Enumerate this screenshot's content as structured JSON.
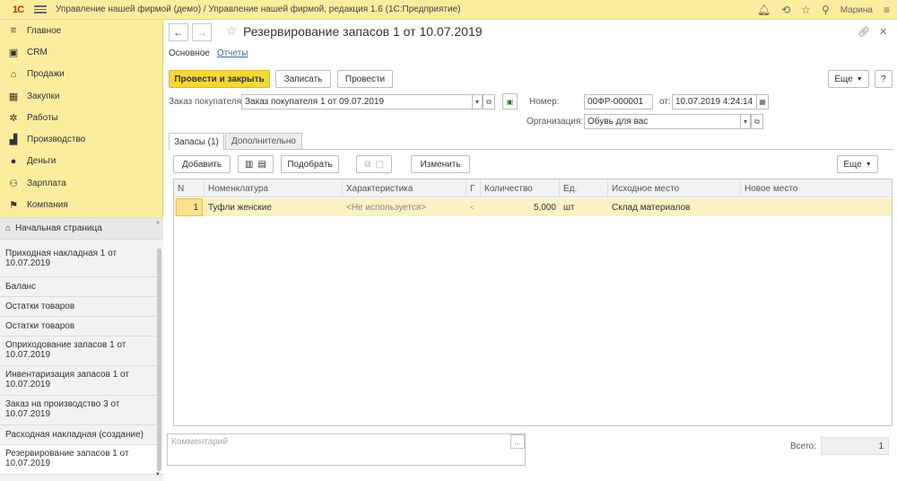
{
  "topbar": {
    "logo": "1C",
    "title": "Управление нашей фирмой (демо) / Управление нашей фирмой, редакция 1.6  (1С:Предприятие)",
    "user": "Марина"
  },
  "sidebar": {
    "items": [
      {
        "label": "Главное",
        "icon": "menu-lines-icon"
      },
      {
        "label": "CRM",
        "icon": "crm-icon"
      },
      {
        "label": "Продажи",
        "icon": "shop-icon"
      },
      {
        "label": "Закупки",
        "icon": "purchase-icon"
      },
      {
        "label": "Работы",
        "icon": "works-icon"
      },
      {
        "label": "Производство",
        "icon": "production-icon"
      },
      {
        "label": "Деньги",
        "icon": "money-icon"
      },
      {
        "label": "Зарплата",
        "icon": "people-icon"
      },
      {
        "label": "Компания",
        "icon": "flag-icon"
      }
    ],
    "open_windows": [
      "Начальная страница",
      "Приходная накладная 1 от 10.07.2019",
      "Баланс",
      "Остатки товаров",
      "Остатки товаров",
      "Оприходование запасов 1 от 10.07.2019",
      "Инвентаризация запасов 1 от 10.07.2019",
      "Заказ на производство 3 от 10.07.2019",
      "Расходная накладная (создание)",
      "Резервирование запасов 1 от 10.07.2019"
    ]
  },
  "document": {
    "title": "Резервирование запасов 1 от 10.07.2019",
    "subtabs": {
      "main": "Основное",
      "reports": "Отчеты"
    }
  },
  "toolbar": {
    "post_close": "Провести и закрыть",
    "save": "Записать",
    "post": "Провести",
    "more": "Еще",
    "help": "?"
  },
  "form": {
    "order_label": "Заказ покупателя:",
    "order_value": "Заказ покупателя 1 от 09.07.2019",
    "number_label": "Номер:",
    "number_value": "00ФР-000001",
    "date_label": "от:",
    "date_value": "10.07.2019  4:24:14",
    "org_label": "Организация:",
    "org_value": "Обувь для вас"
  },
  "tabs": {
    "stock": "Запасы (1)",
    "extra": "Дополнительно"
  },
  "table_toolbar": {
    "add": "Добавить",
    "pick": "Подобрать",
    "change": "Изменить",
    "more": "Еще"
  },
  "table": {
    "headers": {
      "n": "N",
      "item": "Номенклатура",
      "characteristic": "Характеристика",
      "g": "Г",
      "qty": "Количество",
      "unit": "Ед.",
      "source": "Исходное место",
      "new_place": "Новое место"
    },
    "rows": [
      {
        "n": "1",
        "item": "Туфли женские",
        "characteristic": "<Не используется>",
        "g": "<",
        "qty": "5,000",
        "unit": "шт",
        "source": "Склад материалов",
        "new_place": ""
      }
    ]
  },
  "footer": {
    "comment_placeholder": "Комментарий",
    "total_label": "Всего:",
    "total_value": "1"
  }
}
